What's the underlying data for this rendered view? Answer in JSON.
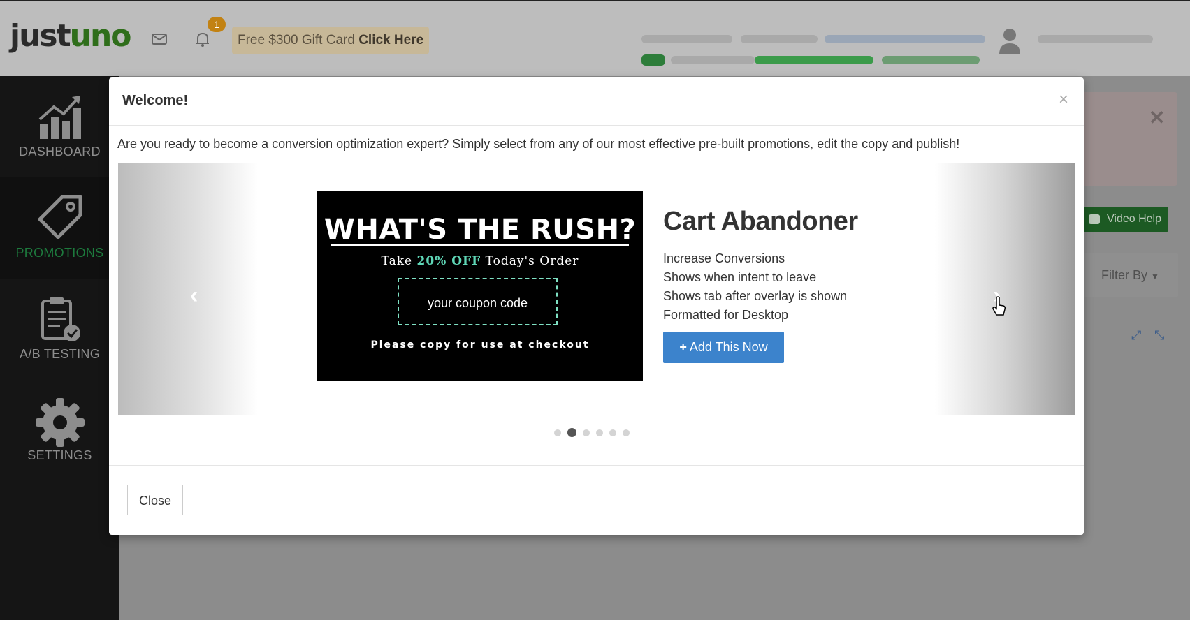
{
  "header": {
    "logo_text": "justuno",
    "notification_count": "1",
    "gift_text": "Free $300 Gift Card",
    "gift_link": "Click Here"
  },
  "sidebar": {
    "items": [
      {
        "label": "DASHBOARD",
        "icon": "chart-icon"
      },
      {
        "label": "PROMOTIONS",
        "icon": "tag-icon",
        "active": true
      },
      {
        "label": "A/B TESTING",
        "icon": "clipboard-check-icon"
      },
      {
        "label": "SETTINGS",
        "icon": "gear-icon"
      }
    ]
  },
  "background": {
    "video_help": "Video Help",
    "filter_by": "Filter By"
  },
  "modal": {
    "title": "Welcome!",
    "close_x": "×",
    "description": "Are you ready to become a conversion optimization expert? Simply select from any of our most effective pre-built promotions, edit the copy and publish!",
    "slide": {
      "image": {
        "headline": "WHAT'S THE RUSH?",
        "sub_pre": "Take ",
        "sub_highlight": "20% OFF",
        "sub_post": " Today's Order",
        "coupon": "your coupon code",
        "footer": "Please copy for use at checkout"
      },
      "name": "Cart Abandoner",
      "features": [
        "Increase Conversions",
        "Shows when intent to leave",
        "Shows tab after overlay is shown",
        "Formatted for Desktop"
      ],
      "add_button": "Add This Now"
    },
    "dots_total": 6,
    "dots_active_index": 1,
    "close_button": "Close"
  },
  "colors": {
    "brand_green": "#2f6e1b",
    "primary_blue": "#3c83cc",
    "coupon_teal": "#5fd6b6"
  }
}
